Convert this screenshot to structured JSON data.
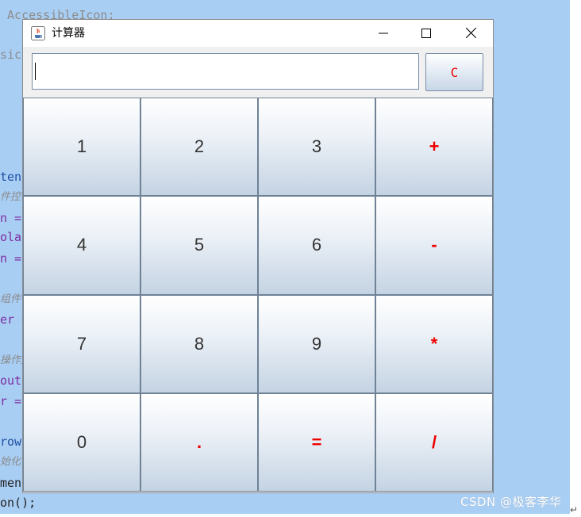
{
  "background_code": {
    "lines": [
      {
        "text": " AccessibleIcon;",
        "class": "gray"
      },
      {
        "text": "sic.",
        "class": "gray"
      },
      {
        "text": "tenc",
        "class": "blue"
      },
      {
        "text": "件控件",
        "class": "italic"
      },
      {
        "text": "n =",
        "class": "purple"
      },
      {
        "text": "olay",
        "class": "purple"
      },
      {
        "text": "n =",
        "class": "purple"
      },
      {
        "text": "组件*",
        "class": "italic"
      },
      {
        "text": "er =",
        "class": "purple"
      },
      {
        "text": "操作变",
        "class": "italic"
      },
      {
        "text": "out",
        "class": "purple"
      },
      {
        "text": "r =",
        "class": "purple"
      },
      {
        "text": "rows",
        "class": "blue"
      },
      {
        "text": "始化",
        "class": "italic"
      },
      {
        "text": "ment",
        "class": "dark"
      },
      {
        "text": "on();",
        "class": "dark"
      }
    ]
  },
  "window": {
    "title": "计算器",
    "icon": "java-cup-icon",
    "controls": {
      "minimize": "minimize-icon",
      "maximize": "maximize-icon",
      "close": "close-icon"
    }
  },
  "display": {
    "value": ""
  },
  "clear_button": {
    "label": "C"
  },
  "keys": [
    {
      "label": "1",
      "op": false,
      "name": "key-1"
    },
    {
      "label": "2",
      "op": false,
      "name": "key-2"
    },
    {
      "label": "3",
      "op": false,
      "name": "key-3"
    },
    {
      "label": "+",
      "op": true,
      "name": "key-plus"
    },
    {
      "label": "4",
      "op": false,
      "name": "key-4"
    },
    {
      "label": "5",
      "op": false,
      "name": "key-5"
    },
    {
      "label": "6",
      "op": false,
      "name": "key-6"
    },
    {
      "label": "-",
      "op": true,
      "name": "key-minus"
    },
    {
      "label": "7",
      "op": false,
      "name": "key-7"
    },
    {
      "label": "8",
      "op": false,
      "name": "key-8"
    },
    {
      "label": "9",
      "op": false,
      "name": "key-9"
    },
    {
      "label": "*",
      "op": true,
      "name": "key-multiply"
    },
    {
      "label": "0",
      "op": false,
      "name": "key-0"
    },
    {
      "label": ".",
      "op": true,
      "name": "key-dot"
    },
    {
      "label": "=",
      "op": true,
      "name": "key-equals"
    },
    {
      "label": "/",
      "op": true,
      "name": "key-divide"
    }
  ],
  "colors": {
    "operator": "#ee0000",
    "digit": "#333333",
    "ide_background": "#a9cef4"
  },
  "watermark": "CSDN @极客李华"
}
